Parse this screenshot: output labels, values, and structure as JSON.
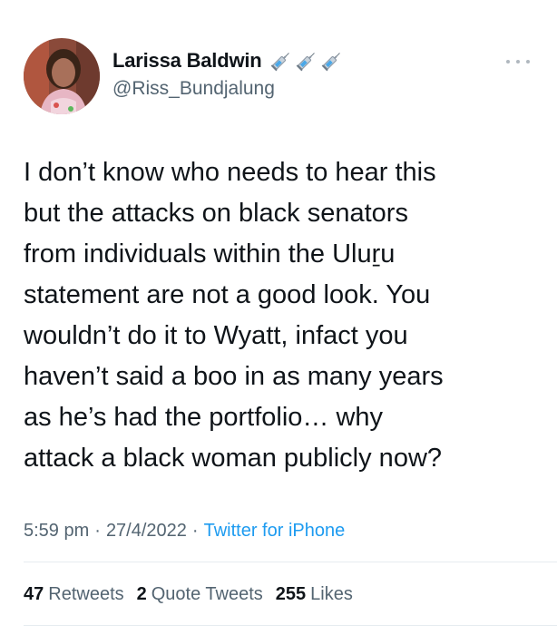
{
  "author": {
    "display_name": "Larissa Baldwin",
    "handle": "@Riss_Bundjalung",
    "name_emojis": [
      "syringe-icon",
      "syringe-icon",
      "syringe-icon"
    ]
  },
  "tweet": {
    "text": "I don’t know who needs to hear this\nbut the attacks on black senators\nfrom individuals within the Uluṟu\nstatement are not a good look. You\nwouldn’t do it to Wyatt, infact you\nhaven’t said a boo in as many years\nas he’s had the portfolio… why\nattack a black woman publicly now?"
  },
  "meta": {
    "time": "5:59 pm",
    "separator": "·",
    "date": "27/4/2022",
    "source": "Twitter for iPhone"
  },
  "stats": {
    "retweets_count": "47",
    "retweets_label": "Retweets",
    "quotes_count": "2",
    "quotes_label": "Quote Tweets",
    "likes_count": "255",
    "likes_label": "Likes"
  },
  "colors": {
    "text": "#0f1419",
    "secondary": "#536471",
    "link": "#1d9bf0",
    "divider": "#e6ecf0"
  }
}
